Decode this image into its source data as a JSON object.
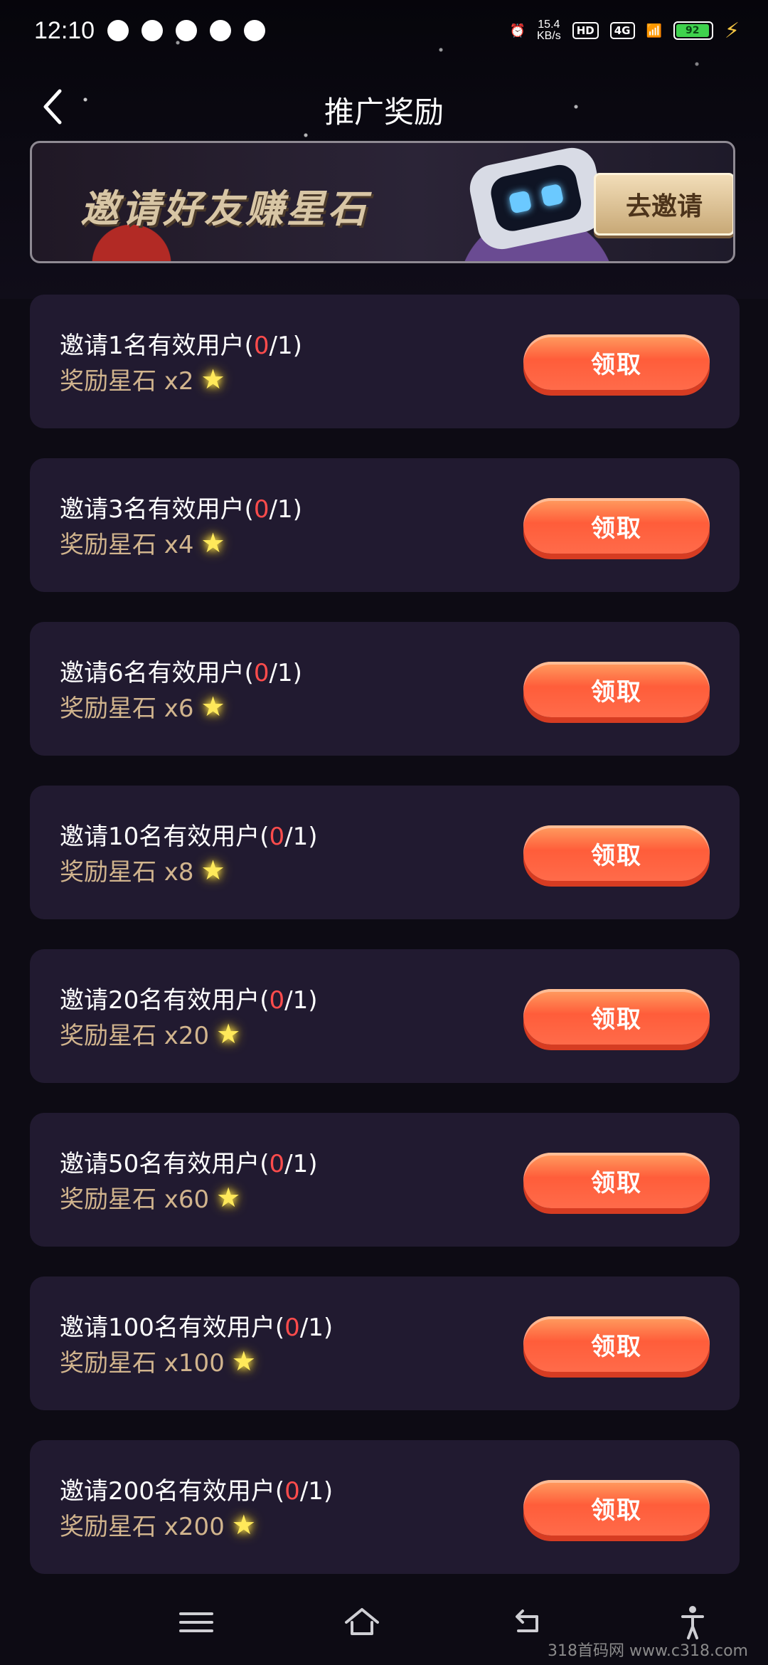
{
  "status": {
    "time": "12:10",
    "net_speed_top": "15.4",
    "net_speed_bottom": "KB/s",
    "hd": "HD",
    "signal": "4G",
    "battery": "92"
  },
  "header": {
    "title": "推广奖励"
  },
  "banner": {
    "title": "邀请好友赚星石",
    "button": "去邀请"
  },
  "tasks": [
    {
      "title_prefix": "邀请1名有效用户(",
      "progress_current": "0",
      "progress_suffix": "/1)",
      "reward": "奖励星石 x2",
      "button": "领取"
    },
    {
      "title_prefix": "邀请3名有效用户(",
      "progress_current": "0",
      "progress_suffix": "/1)",
      "reward": "奖励星石 x4",
      "button": "领取"
    },
    {
      "title_prefix": "邀请6名有效用户(",
      "progress_current": "0",
      "progress_suffix": "/1)",
      "reward": "奖励星石 x6",
      "button": "领取"
    },
    {
      "title_prefix": "邀请10名有效用户(",
      "progress_current": "0",
      "progress_suffix": "/1)",
      "reward": "奖励星石 x8",
      "button": "领取"
    },
    {
      "title_prefix": "邀请20名有效用户(",
      "progress_current": "0",
      "progress_suffix": "/1)",
      "reward": "奖励星石 x20",
      "button": "领取"
    },
    {
      "title_prefix": "邀请50名有效用户(",
      "progress_current": "0",
      "progress_suffix": "/1)",
      "reward": "奖励星石 x60",
      "button": "领取"
    },
    {
      "title_prefix": "邀请100名有效用户(",
      "progress_current": "0",
      "progress_suffix": "/1)",
      "reward": "奖励星石 x100",
      "button": "领取"
    },
    {
      "title_prefix": "邀请200名有效用户(",
      "progress_current": "0",
      "progress_suffix": "/1)",
      "reward": "奖励星石 x200",
      "button": "领取"
    }
  ],
  "watermark": "318首码网 www.c318.com",
  "colors": {
    "card_bg": "#211a30",
    "progress_red": "#ff4c4c",
    "reward_gold": "#d1b48d",
    "button_orange": "#ff5d3a"
  }
}
